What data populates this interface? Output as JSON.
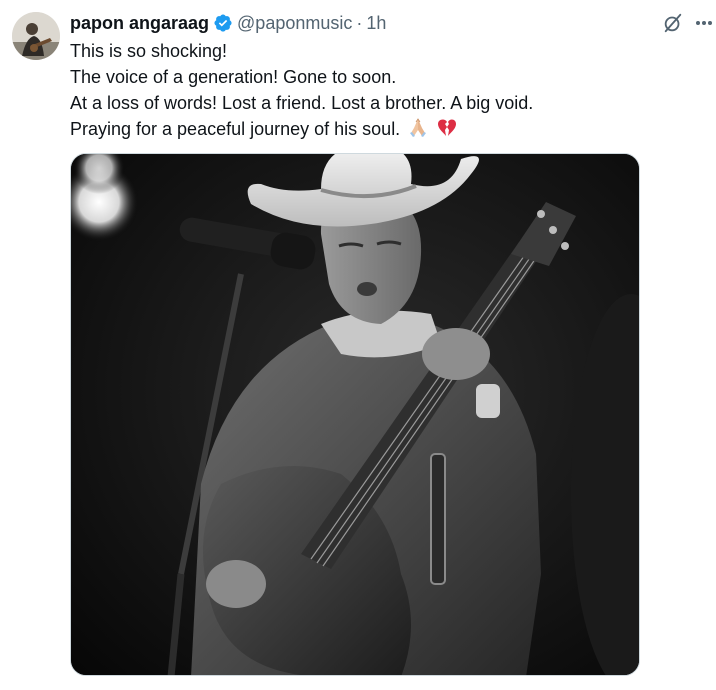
{
  "tweet": {
    "author": {
      "display_name": "papon angaraag",
      "handle": "@paponmusic",
      "verified": true,
      "verified_color": "#1d9bf0"
    },
    "separator": "·",
    "time": "1h",
    "lines": [
      "This is so shocking!",
      "The voice of a generation! Gone to soon.",
      "At a loss of words! Lost a friend. Lost a brother. A big void.",
      "Praying for a peaceful journey of his soul."
    ],
    "emojis": [
      "folded-hands",
      "broken-heart"
    ],
    "actions": {
      "grok_icon": "grok-icon",
      "more_icon": "more-icon"
    }
  },
  "colors": {
    "text": "#0f1419",
    "secondary": "#536471",
    "border": "#cfd9de"
  }
}
